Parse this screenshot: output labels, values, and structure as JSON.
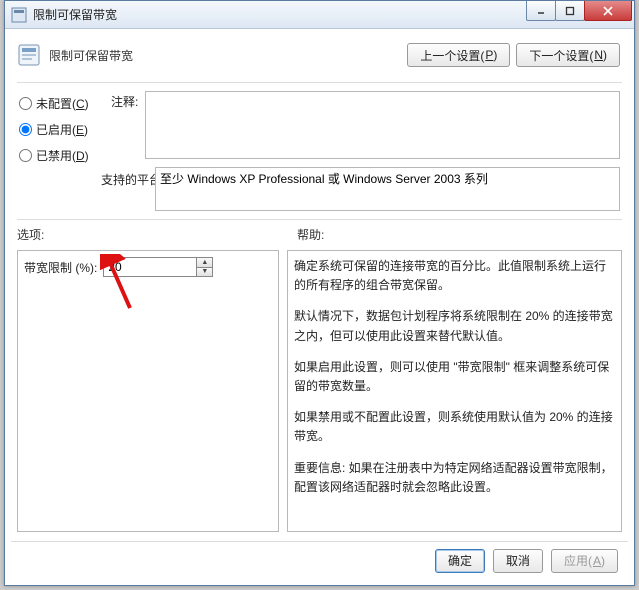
{
  "window": {
    "title": "限制可保留带宽"
  },
  "titlebar_controls": {
    "minimize": "–",
    "maximize": "□",
    "close": "×"
  },
  "header": {
    "title": "限制可保留带宽",
    "prev_btn": "上一个设置(",
    "prev_key": "P",
    "prev_btn_tail": ")",
    "next_btn": "下一个设置(",
    "next_key": "N",
    "next_btn_tail": ")"
  },
  "state_radios": {
    "not_configured": "未配置(",
    "not_configured_key": "C",
    "not_configured_tail": ")",
    "enabled": "已启用(",
    "enabled_key": "E",
    "enabled_tail": ")",
    "disabled": "已禁用(",
    "disabled_key": "D",
    "disabled_tail": ")",
    "selected": "enabled"
  },
  "labels": {
    "comment": "注释:",
    "supported": "支持的平台:",
    "options": "选项:",
    "help": "帮助:"
  },
  "comment_value": "",
  "supported_value": "至少 Windows XP Professional 或 Windows Server 2003 系列",
  "options_pane": {
    "field_label": "带宽限制 (%):",
    "value": "20"
  },
  "help_pane": {
    "p1": "确定系统可保留的连接带宽的百分比。此值限制系统上运行的所有程序的组合带宽保留。",
    "p2": "默认情况下，数据包计划程序将系统限制在 20% 的连接带宽之内，但可以使用此设置来替代默认值。",
    "p3": "如果启用此设置，则可以使用 \"带宽限制\" 框来调整系统可保留的带宽数量。",
    "p4": "如果禁用或不配置此设置，则系统使用默认值为 20% 的连接带宽。",
    "p5": "重要信息: 如果在注册表中为特定网络适配器设置带宽限制，配置该网络适配器时就会忽略此设置。"
  },
  "footer": {
    "ok": "确定",
    "cancel": "取消",
    "apply": "应用(",
    "apply_key": "A",
    "apply_tail": ")"
  }
}
